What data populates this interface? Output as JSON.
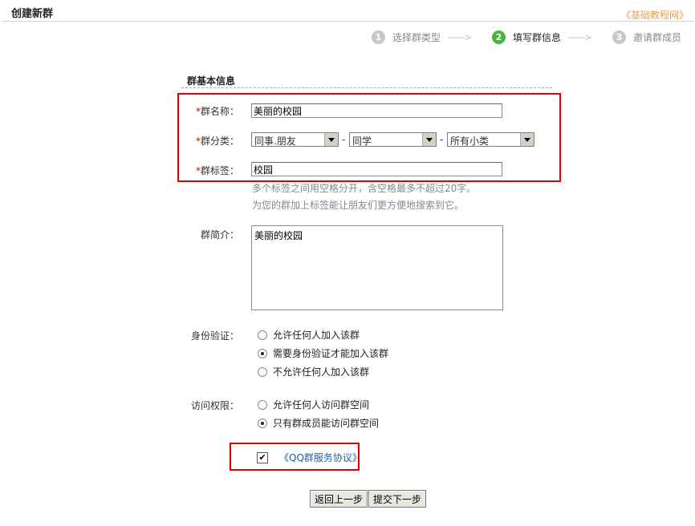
{
  "header": {
    "title": "创建新群",
    "brand": "《基础教程网》"
  },
  "steps": [
    {
      "num": "1",
      "label": "选择群类型"
    },
    {
      "num": "2",
      "label": "填写群信息"
    },
    {
      "num": "3",
      "label": "邀请群成员"
    }
  ],
  "step_arrow": "------->",
  "section": {
    "title": "群基本信息"
  },
  "form": {
    "name": {
      "asterisk": "*",
      "label": "群名称：",
      "value": "美丽的校园"
    },
    "category": {
      "asterisk": "*",
      "label": "群分类：",
      "selected": [
        "同事.朋友",
        "同学",
        "所有小类"
      ],
      "dash": "-"
    },
    "tags": {
      "asterisk": "*",
      "label": "群标签：",
      "value": "校园",
      "hint1": "多个标签之间用空格分开，含空格最多不超过20字。",
      "hint2": "为您的群加上标签能让朋友们更方便地搜索到它。"
    },
    "intro": {
      "label": "群简介：",
      "value": "美丽的校园"
    },
    "auth": {
      "label": "身份验证：",
      "options": [
        "允许任何人加入该群",
        "需要身份验证才能加入该群",
        "不允许任何人加入该群"
      ],
      "selected_index": 1
    },
    "access": {
      "label": "访问权限：",
      "options": [
        "允许任何人访问群空间",
        "只有群成员能访问群空间"
      ],
      "selected_index": 1
    },
    "agreement": {
      "checked": true,
      "checkmark": "✔",
      "label": "《QQ群服务协议》"
    }
  },
  "buttons": {
    "prev": "返回上一步",
    "next": "提交下一步"
  }
}
